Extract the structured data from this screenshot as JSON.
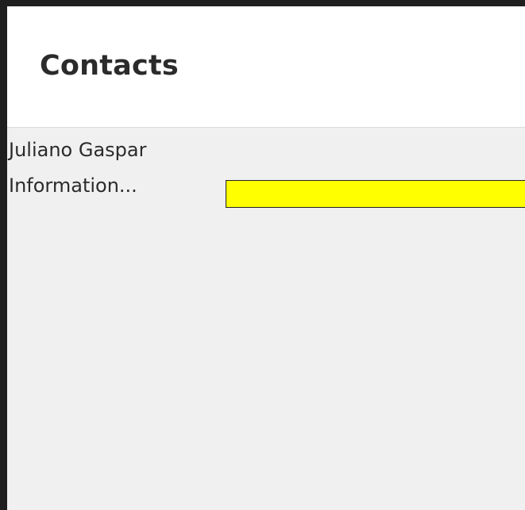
{
  "header": {
    "title": "Contacts"
  },
  "contacts": [
    {
      "name": "Juliano Gaspar",
      "detail": "Information..."
    }
  ],
  "colors": {
    "frame": "#1f1f1f",
    "header_background": "#ffffff",
    "content_background": "#f0f0f0",
    "highlight": "#ffff00",
    "text": "#2b2b2b"
  }
}
